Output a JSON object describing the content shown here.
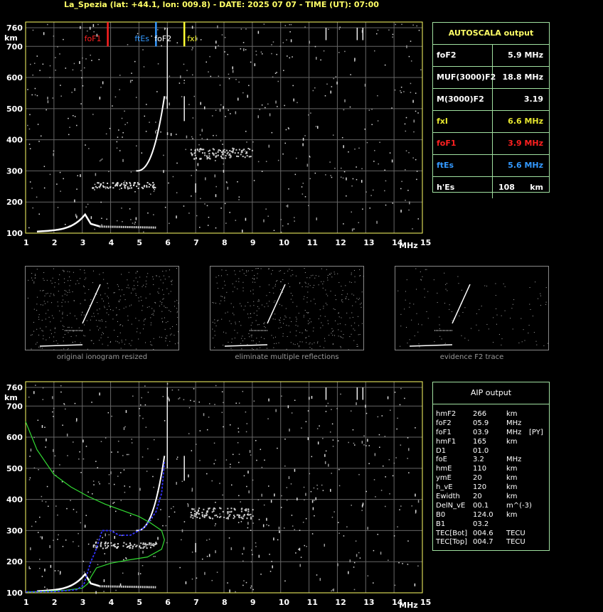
{
  "header": {
    "title": "La_Spezia (lat: +44.1, lon: 009.8) - DATE: 2025 07 07 - TIME (UT): 07:00"
  },
  "ionogram": {
    "y_unit": "km",
    "x_unit": "MHz",
    "y_ticks": [
      "760",
      "700",
      "600",
      "500",
      "400",
      "300",
      "200",
      "100"
    ],
    "x_ticks": [
      "1",
      "2",
      "3",
      "4",
      "5",
      "6",
      "7",
      "8",
      "9",
      "10",
      "11",
      "12",
      "13",
      "14",
      "15"
    ],
    "markers": [
      {
        "label": "foF1",
        "color": "#ff2020"
      },
      {
        "label": "ftEs",
        "color": "#3399ff"
      },
      {
        "label": "foF2",
        "color": "#ffffff"
      },
      {
        "label": "fxI",
        "color": "#ffff33"
      }
    ]
  },
  "autoscala": {
    "title": "AUTOSCALA output",
    "rows": [
      {
        "label": "foF2",
        "value": "5.9 MHz",
        "color": "#ffffff"
      },
      {
        "label": "MUF(3000)F2",
        "value": "18.8 MHz",
        "color": "#ffffff"
      },
      {
        "label": "M(3000)F2",
        "value": "3.19",
        "color": "#ffffff"
      },
      {
        "label": "fxI",
        "value": "6.6 MHz",
        "color": "#e6e62e"
      },
      {
        "label": "foF1",
        "value": "3.9 MHz",
        "color": "#ff2020"
      },
      {
        "label": "ftEs",
        "value": "5.6 MHz",
        "color": "#3399ff"
      },
      {
        "label": "h'Es",
        "value": "108",
        "unit": "km",
        "color": "#ffffff"
      }
    ]
  },
  "thumbnails": {
    "captions": [
      "original ionogram resized",
      "eliminate multiple reflections",
      "evidence F2 trace"
    ]
  },
  "aip": {
    "title": "AIP output",
    "rows": [
      {
        "name": "hmF2",
        "value": "266",
        "unit": "km",
        "flag": ""
      },
      {
        "name": "foF2",
        "value": "05.9",
        "unit": "MHz",
        "flag": ""
      },
      {
        "name": "foF1",
        "value": "03.9",
        "unit": "MHz",
        "flag": "[PY]"
      },
      {
        "name": "hmF1",
        "value": "165",
        "unit": "km",
        "flag": ""
      },
      {
        "name": "D1",
        "value": "01.0",
        "unit": "",
        "flag": ""
      },
      {
        "name": "foE",
        "value": "3.2",
        "unit": "MHz",
        "flag": ""
      },
      {
        "name": "hmE",
        "value": "110",
        "unit": "km",
        "flag": ""
      },
      {
        "name": "ymE",
        "value": "20",
        "unit": "km",
        "flag": ""
      },
      {
        "name": "h_vE",
        "value": "120",
        "unit": "km",
        "flag": ""
      },
      {
        "name": "Ewidth",
        "value": "20",
        "unit": "km",
        "flag": ""
      },
      {
        "name": "DelN_vE",
        "value": "00.1",
        "unit": "m^(-3)",
        "flag": ""
      },
      {
        "name": "B0",
        "value": "124.0",
        "unit": "km",
        "flag": ""
      },
      {
        "name": "B1",
        "value": "03.2",
        "unit": "",
        "flag": ""
      },
      {
        "name": "TEC[Bot]",
        "value": "004.6",
        "unit": "TECU",
        "flag": ""
      },
      {
        "name": "TEC[Top]",
        "value": "004.7",
        "unit": "TECU",
        "flag": ""
      }
    ]
  }
}
